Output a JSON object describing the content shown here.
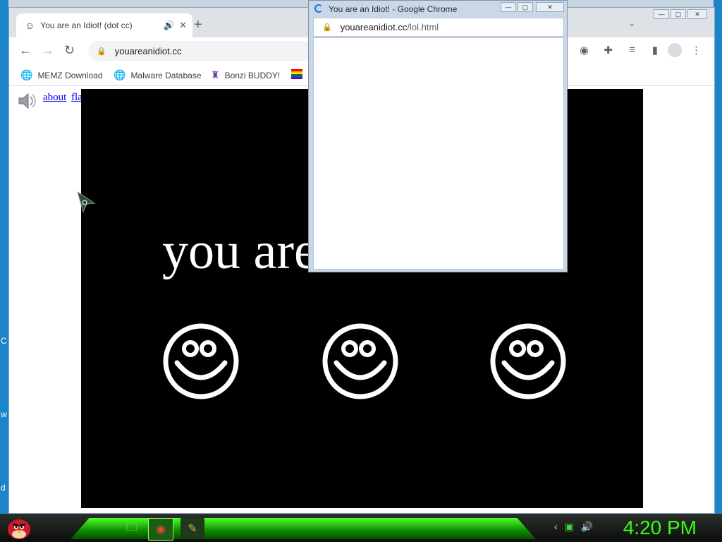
{
  "desktop": {
    "left_glyphs": [
      "C",
      "w",
      "d"
    ]
  },
  "main_window": {
    "tab": {
      "title": "You are an Idiot! (dot cc)",
      "favicon": "smiley-icon",
      "audio": "🔊",
      "close": "✕"
    },
    "new_tab": "+",
    "controls": [
      "—",
      "▢",
      "✕"
    ],
    "url": "youareanidiot.cc",
    "bookmarks": [
      {
        "label": "MEMZ Download",
        "icon": "globe-icon"
      },
      {
        "label": "Malware Database",
        "icon": "globe-icon"
      },
      {
        "label": "Bonzi BUDDY!",
        "icon": "bonzi-icon"
      }
    ]
  },
  "page": {
    "links": {
      "about": "about",
      "flash": "flash"
    },
    "big_text": "you are an idiot",
    "smiley_count": 3
  },
  "popup": {
    "title": "You are an Idiot! - Google Chrome",
    "url_host": "youareanidiot.cc",
    "url_path": "/lol.html",
    "controls": [
      "—",
      "▢",
      "✕"
    ]
  },
  "taskbar": {
    "clock": "4:20 PM"
  },
  "colors": {
    "desktop": "#1a86c9",
    "taskbar_glow": "#4cff2a",
    "clock": "#39ff14"
  }
}
